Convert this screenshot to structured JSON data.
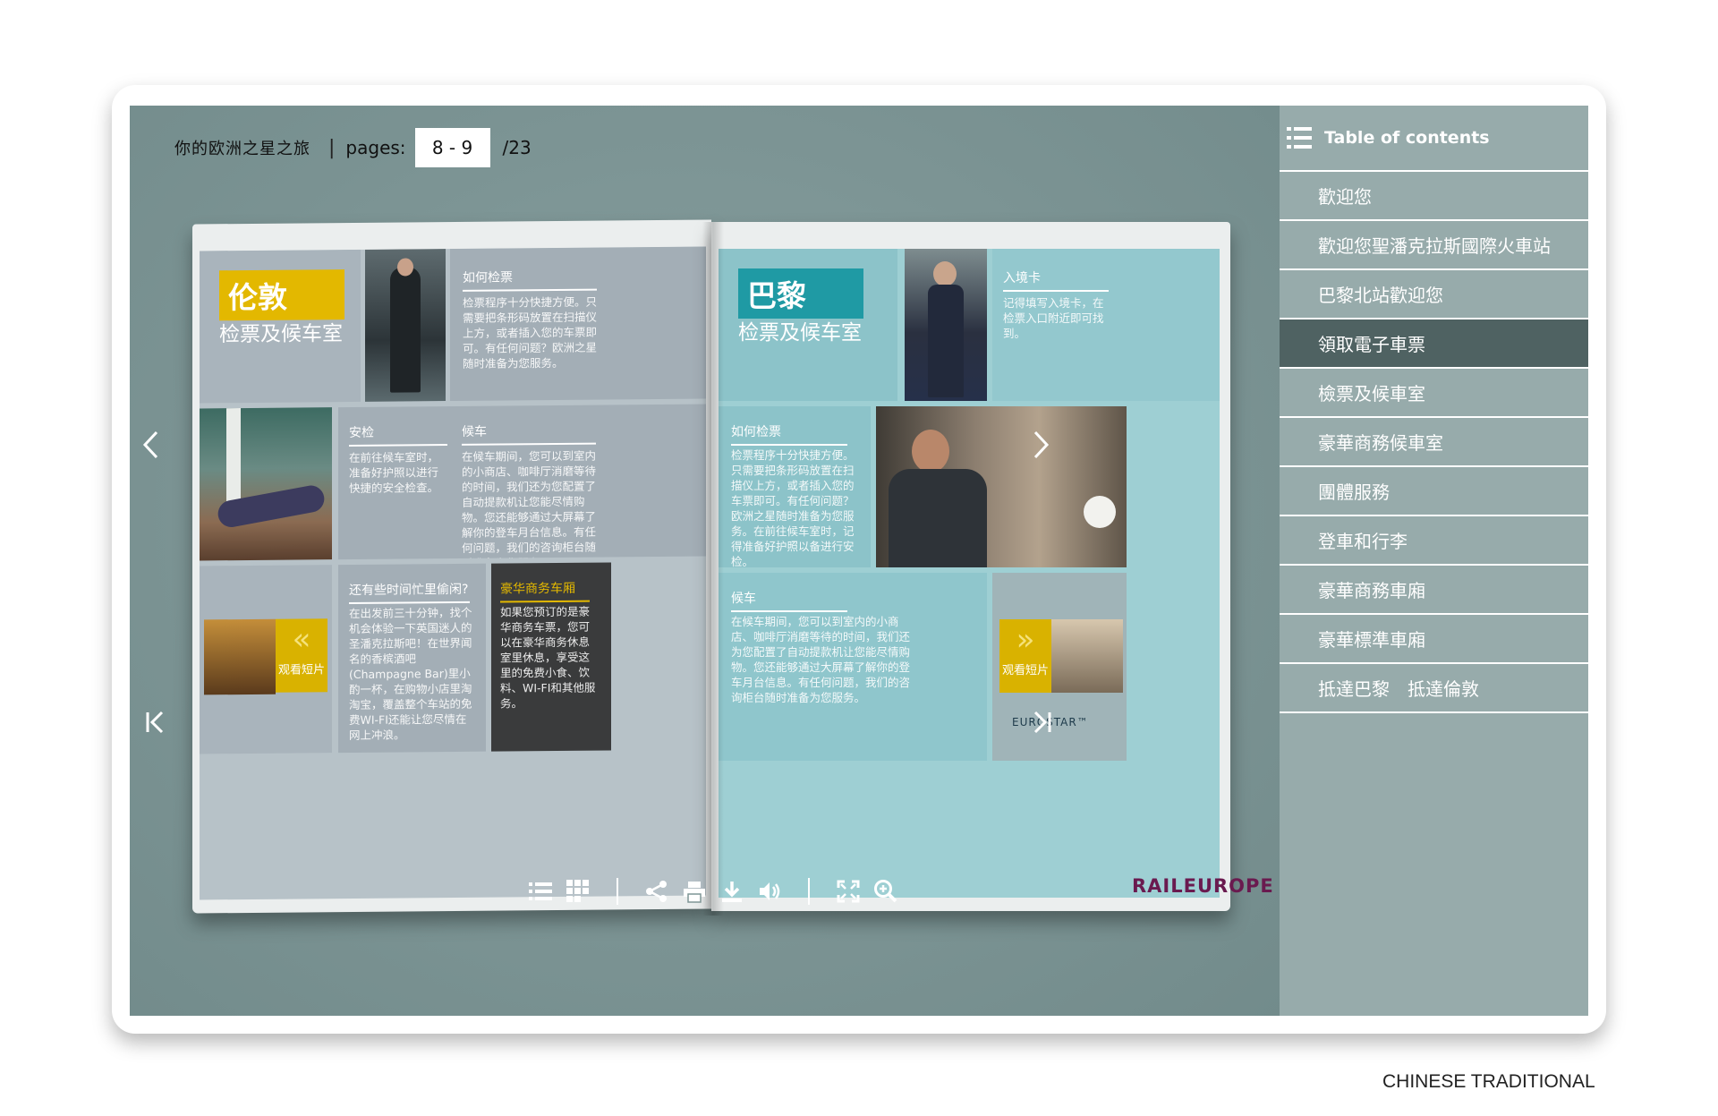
{
  "header": {
    "publication_title": "你的欧洲之星之旅",
    "separator": "|",
    "pages_label": "pages:",
    "current_pages": "8 - 9",
    "total_pages": "/23"
  },
  "toc": {
    "header_label": "Table of contents",
    "items": [
      {
        "label": "歡迎您"
      },
      {
        "label": "歡迎您聖潘克拉斯國際火車站"
      },
      {
        "label": "巴黎北站歡迎您"
      },
      {
        "label": "領取電子車票"
      },
      {
        "label": "檢票及候車室"
      },
      {
        "label": "豪華商務候車室"
      },
      {
        "label": "團體服務"
      },
      {
        "label": "登車和行李"
      },
      {
        "label": "豪華商務車廂"
      },
      {
        "label": "豪華標準車廂"
      },
      {
        "label": "抵達巴黎　抵達倫敦"
      }
    ],
    "active_index": 3
  },
  "book": {
    "left_page": {
      "city_title": "伦敦",
      "city_subtitle": "检票及候车室",
      "how_check_title": "如何检票",
      "how_check_text": "检票程序十分快捷方便。只需要把条形码放置在扫描仪上方，或者插入您的车票即可。有任何问题？欧洲之星随时准备为您服务。",
      "security_title": "安检",
      "security_text": "在前往候车室时，准备好护照以进行快捷的安全检查。",
      "waiting_title": "候车",
      "waiting_text": "在候车期间，您可以到室内的小商店、咖啡厅消磨等待的时间，我们还为您配置了自动提款机让您能尽情购物。您还能够通过大屏幕了解你的登车月台信息。有任何问题，我们的咨询柜台随时准备为您服务。",
      "spare_title": "还有些时间忙里偷闲?",
      "spare_text": "在出发前三十分钟，找个机会体验一下英国迷人的圣潘克拉斯吧！在世界闻名的香槟酒吧(Champagne Bar)里小酌一杯，在购物小店里淘淘宝，覆盖整个车站的免费WI-FI还能让您尽情在网上冲浪。",
      "business_title": "豪华商务车厢",
      "business_text": "如果您预订的是豪华商务车票，您可以在豪华商务休息室里休息，享受这里的免费小食、饮料、WI-FI和其他服务。",
      "video_label": "观看短片"
    },
    "right_page": {
      "city_title": "巴黎",
      "city_subtitle": "检票及候车室",
      "entry_title": "入境卡",
      "entry_text": "记得填写入境卡，在检票入口附近即可找到。",
      "how_check_title": "如何检票",
      "how_check_text": "检票程序十分快捷方便。只需要把条形码放置在扫描仪上方，或者插入您的车票即可。有任何问题？欧洲之星随时准备为您服务。在前往候车室时，记得准备好护照以备进行安检。",
      "waiting_title": "候车",
      "waiting_text": "在候车期间，您可以到室内的小商店、咖啡厅消磨等待的时间，我们还为您配置了自动提款机让您能尽情购物。您还能够通过大屏幕了解你的登车月台信息。有任何问题，我们的咨询柜台随时准备为您服务。",
      "video_label": "观看短片",
      "logo_text": "EUROSTAR™"
    }
  },
  "bottom_toolbar": {
    "icons": [
      "list-icon",
      "thumbnails-icon",
      "share-icon",
      "print-icon",
      "download-icon",
      "sound-icon",
      "fullscreen-icon",
      "zoom-in-icon"
    ]
  },
  "brand": {
    "logo_text": "RAILEUROPE"
  },
  "caption": "CHINESE TRADITIONAL",
  "colors": {
    "viewer_bg": "#7f9696",
    "toc_bg": "#97abab",
    "toc_active": "#4f6262",
    "left_accent": "#e3b800",
    "right_accent": "#1f9aa4",
    "brand": "#6a1a4f"
  }
}
